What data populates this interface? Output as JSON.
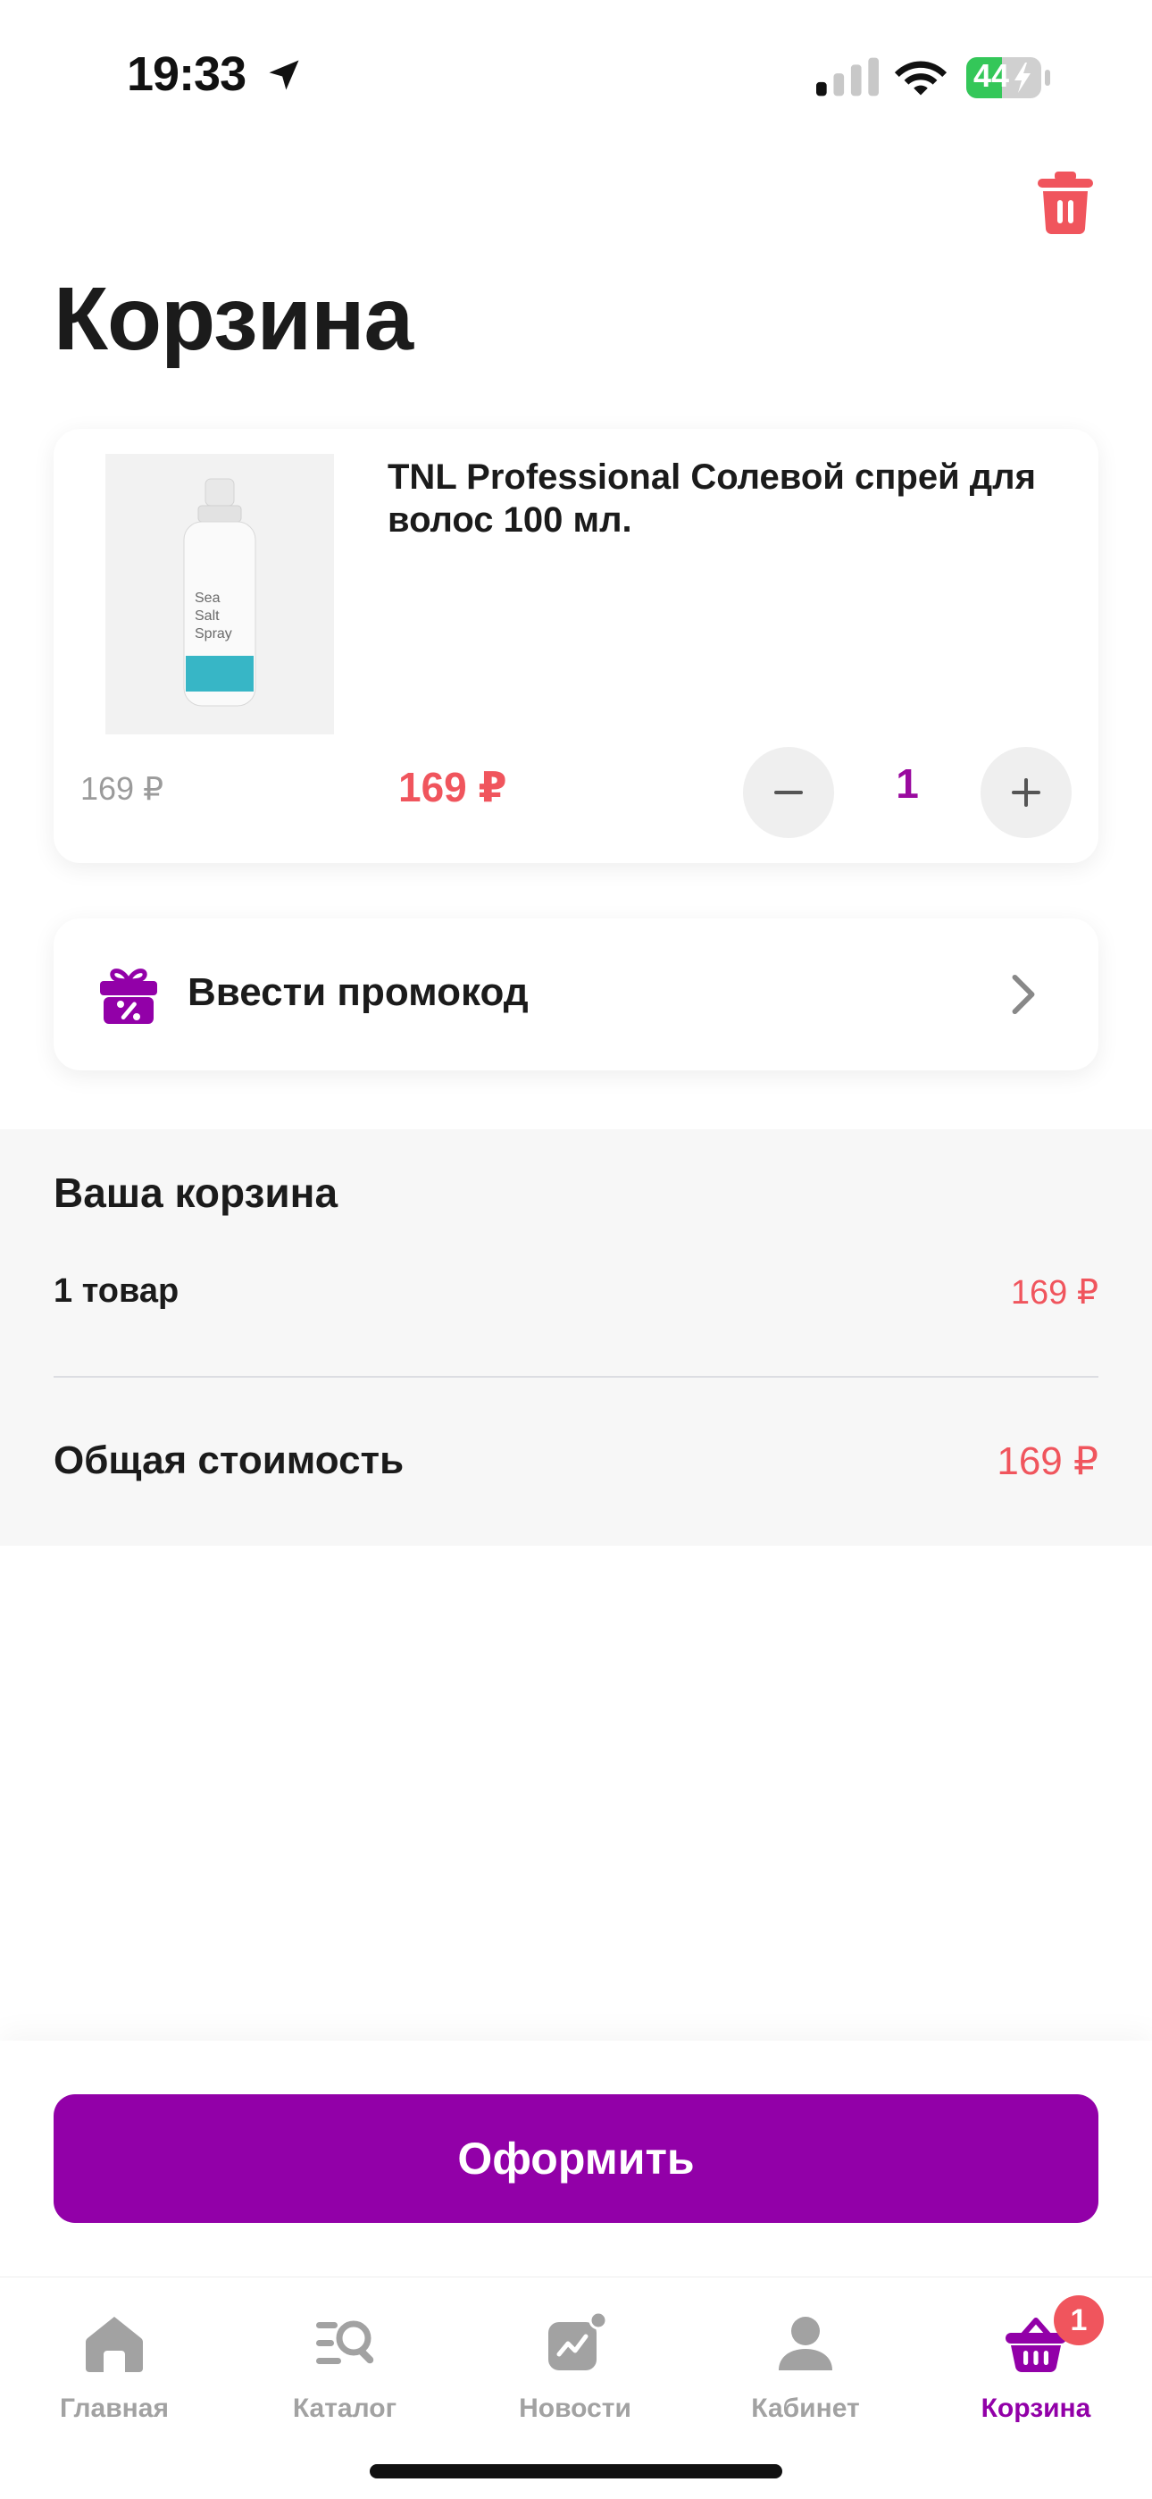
{
  "status_bar": {
    "time": "19:33",
    "battery": "44",
    "battery_color": "#34c759"
  },
  "header": {
    "title": "Корзина",
    "delete_icon": "trash-icon",
    "delete_color": "#f0555d"
  },
  "cart_item": {
    "name": "TNL Professional Солевой спрей для волос 100 мл.",
    "image_text": [
      "Sea",
      "Salt",
      "Spray"
    ],
    "old_price": "169 ₽",
    "price": "169 ₽",
    "quantity": "1",
    "minus_icon": "minus-icon",
    "plus_icon": "plus-icon"
  },
  "promo": {
    "label": "Ввести промокод",
    "icon": "gift-percent-icon"
  },
  "summary": {
    "title": "Ваша корзина",
    "items_label": "1 товар",
    "items_price": "169 ₽",
    "total_label": "Общая стоимость",
    "total_price": "169 ₽"
  },
  "checkout": {
    "label": "Оформить",
    "color": "#9200a8"
  },
  "tabbar": {
    "tabs": [
      {
        "label": "Главная",
        "icon": "home-icon"
      },
      {
        "label": "Каталог",
        "icon": "catalog-search-icon"
      },
      {
        "label": "Новости",
        "icon": "news-chart-icon"
      },
      {
        "label": "Кабинет",
        "icon": "user-icon"
      },
      {
        "label": "Корзина",
        "icon": "basket-icon",
        "active": true,
        "badge": "1"
      }
    ]
  }
}
